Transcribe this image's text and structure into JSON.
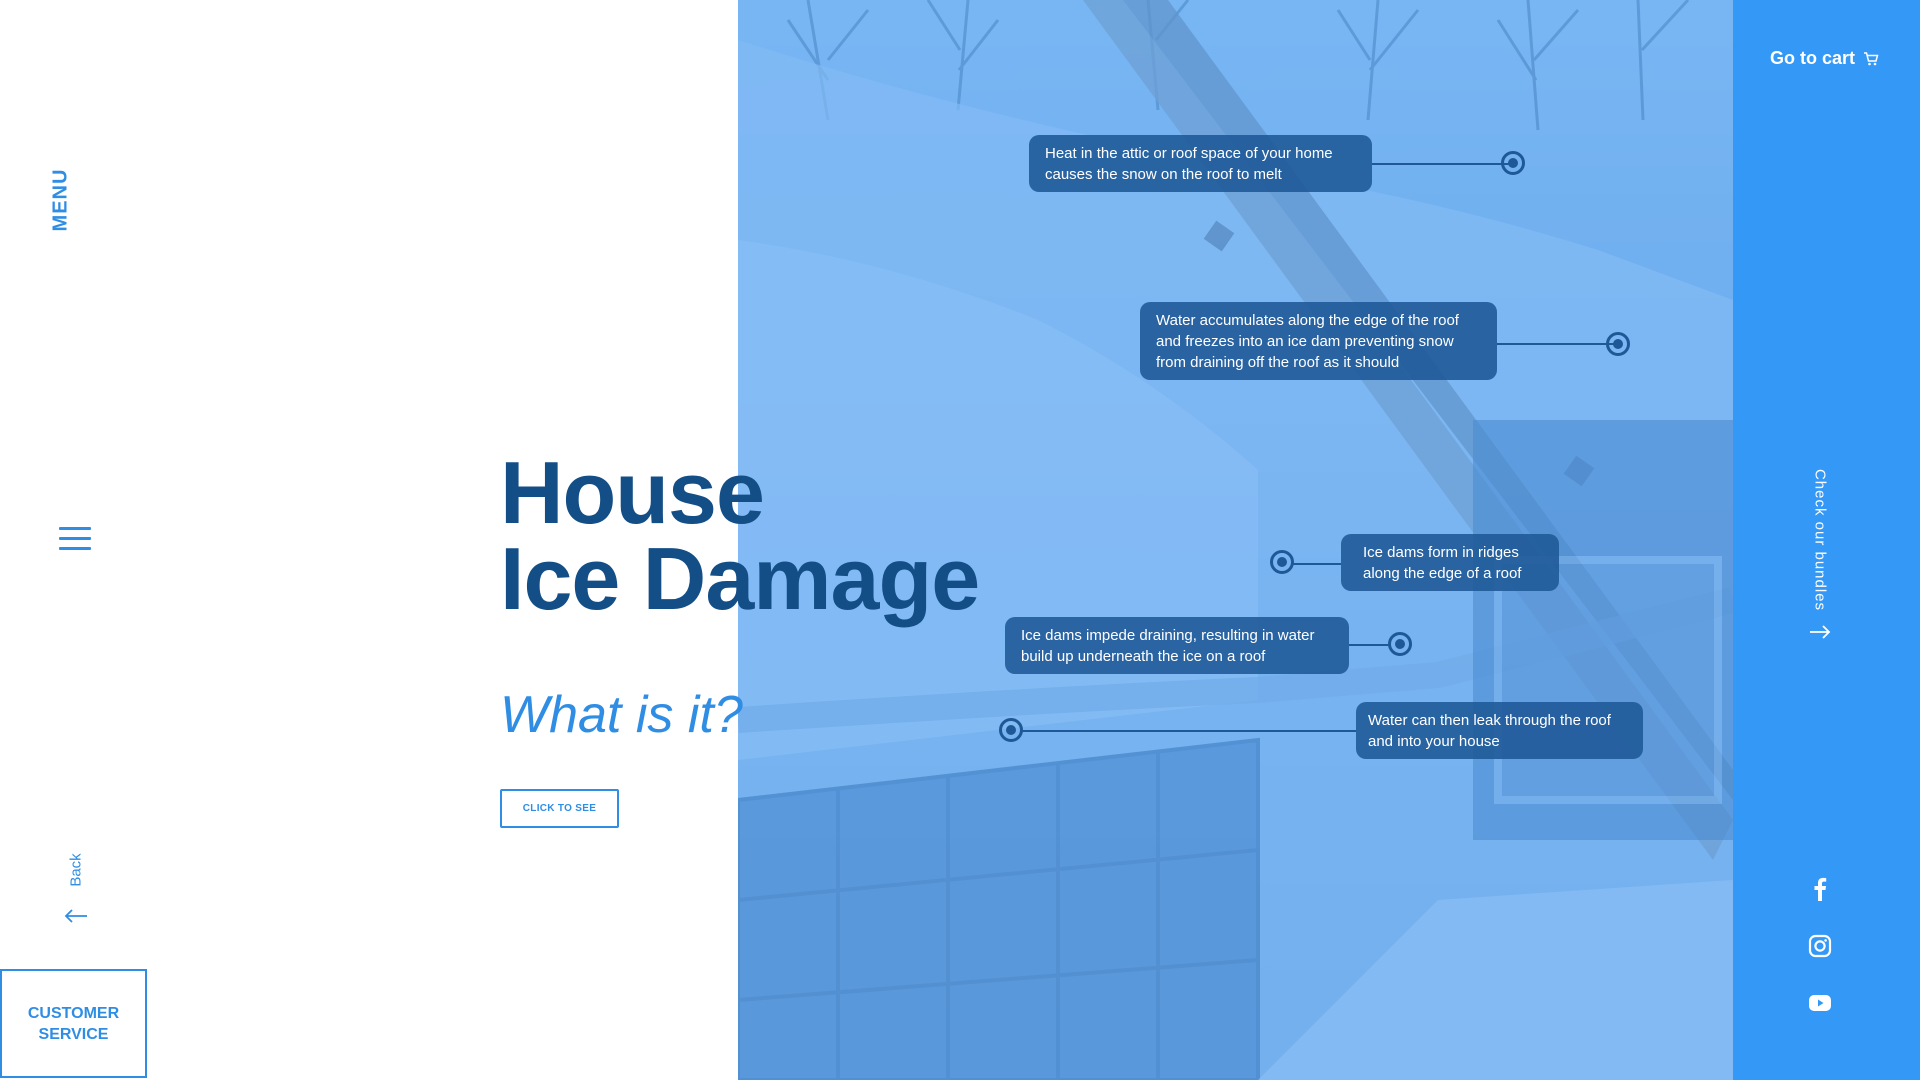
{
  "left_rail": {
    "menu_label": "MENU",
    "hamburger_icon": "hamburger-icon",
    "back_label": "Back",
    "back_icon": "arrow-left-icon",
    "customer_service_label": "CUSTOMER SERVICE"
  },
  "hero": {
    "title_line1": "House",
    "title_line2": "Ice Damage",
    "subtitle": "What is it?",
    "cta_label": "CLICK TO SEE"
  },
  "callouts": [
    {
      "lines": [
        "Heat in the attic or roof space of your home",
        "causes the snow on the roof to melt"
      ]
    },
    {
      "lines": [
        "Water accumulates along the edge of the roof",
        "and freezes into an ice dam preventing snow",
        "from draining off the roof as it should"
      ]
    },
    {
      "lines": [
        "Ice dams form in ridges",
        "along the edge of a roof"
      ]
    },
    {
      "lines": [
        "Ice dams impede draining, resulting in water",
        "build up underneath the ice on a roof"
      ]
    },
    {
      "lines": [
        "Water can then leak through the roof",
        "and into your house"
      ]
    }
  ],
  "right_rail": {
    "cart_label": "Go to cart",
    "cart_icon": "cart-icon",
    "bundles_label": "Check our bundles",
    "bundles_icon": "arrow-right-icon",
    "social": [
      "facebook-icon",
      "instagram-icon",
      "youtube-icon"
    ]
  },
  "colors": {
    "brand_blue": "#2f8ee4",
    "title_navy": "#134e87",
    "rail_blue": "#3498f7",
    "callout_bg": "#1e5896"
  }
}
